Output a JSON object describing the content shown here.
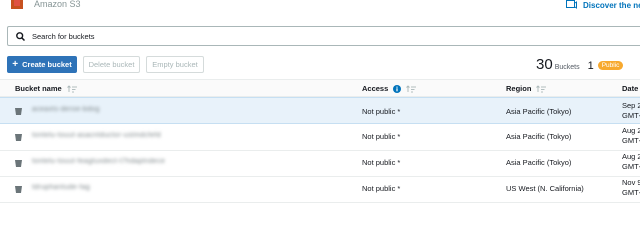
{
  "header": {
    "app_title": "Amazon S3",
    "discover_label": "Discover the new"
  },
  "search": {
    "placeholder": "Search for buckets",
    "value": ""
  },
  "toolbar": {
    "create_label": "Create bucket",
    "delete_label": "Delete bucket",
    "empty_label": "Empty bucket"
  },
  "summary": {
    "bucket_count": "30",
    "buckets_label": "Buckets",
    "public_count": "1",
    "public_label": "Public"
  },
  "table": {
    "columns": {
      "name": "Bucket name",
      "access": "Access",
      "region": "Region",
      "date": "Date"
    },
    "rows": [
      {
        "name": "aceaxts-deroe-bdog",
        "access": "Not public *",
        "region": "Asia Pacific (Tokyo)",
        "date_line1": "Sep 2",
        "date_line2": "GMT+",
        "selected": true
      },
      {
        "name": "tontelu-touut-asacntductor-ustmdcfefd",
        "access": "Not public *",
        "region": "Asia Pacific (Tokyo)",
        "date_line1": "Aug 2",
        "date_line2": "GMT+",
        "selected": false
      },
      {
        "name": "tontelu-touut-feagtuxdect-t7hdaplndece",
        "access": "Not public *",
        "region": "Asia Pacific (Tokyo)",
        "date_line1": "Aug 2",
        "date_line2": "GMT+",
        "selected": false
      },
      {
        "name": "tdruphantude-fag",
        "access": "Not public *",
        "region": "US West (N. California)",
        "date_line1": "Nov 9",
        "date_line2": "GMT+",
        "selected": false
      }
    ]
  },
  "colors": {
    "primary": "#2e73b8",
    "link": "#0073bb",
    "public_badge": "#f7a92f",
    "selected_row": "#e8f2fa"
  }
}
